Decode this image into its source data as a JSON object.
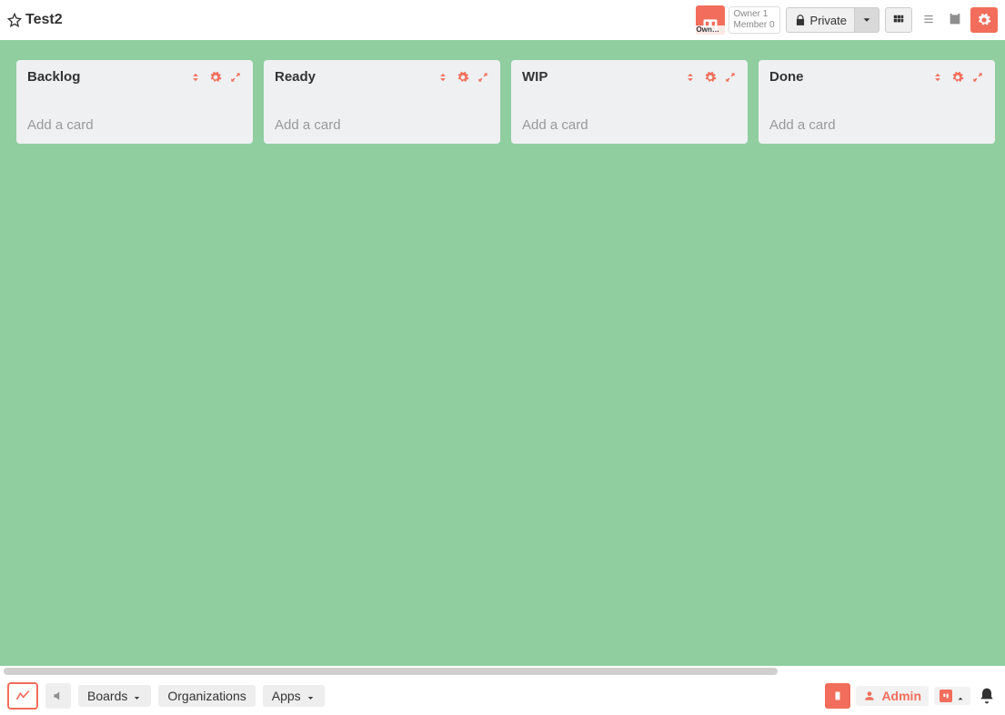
{
  "header": {
    "board_title": "Test2",
    "owner_badge_label": "Own…",
    "owner_line1": "Owner 1",
    "owner_line2": "Member 0",
    "privacy_label": "Private"
  },
  "lists": [
    {
      "title": "Backlog",
      "add_label": "Add a card"
    },
    {
      "title": "Ready",
      "add_label": "Add a card"
    },
    {
      "title": "WIP",
      "add_label": "Add a card"
    },
    {
      "title": "Done",
      "add_label": "Add a card"
    }
  ],
  "footer": {
    "boards_label": "Boards",
    "orgs_label": "Organizations",
    "apps_label": "Apps",
    "user_label": "Admin"
  },
  "colors": {
    "accent": "#f26d5b",
    "canvas": "#90ce9f",
    "list_bg": "#eef0f2"
  }
}
